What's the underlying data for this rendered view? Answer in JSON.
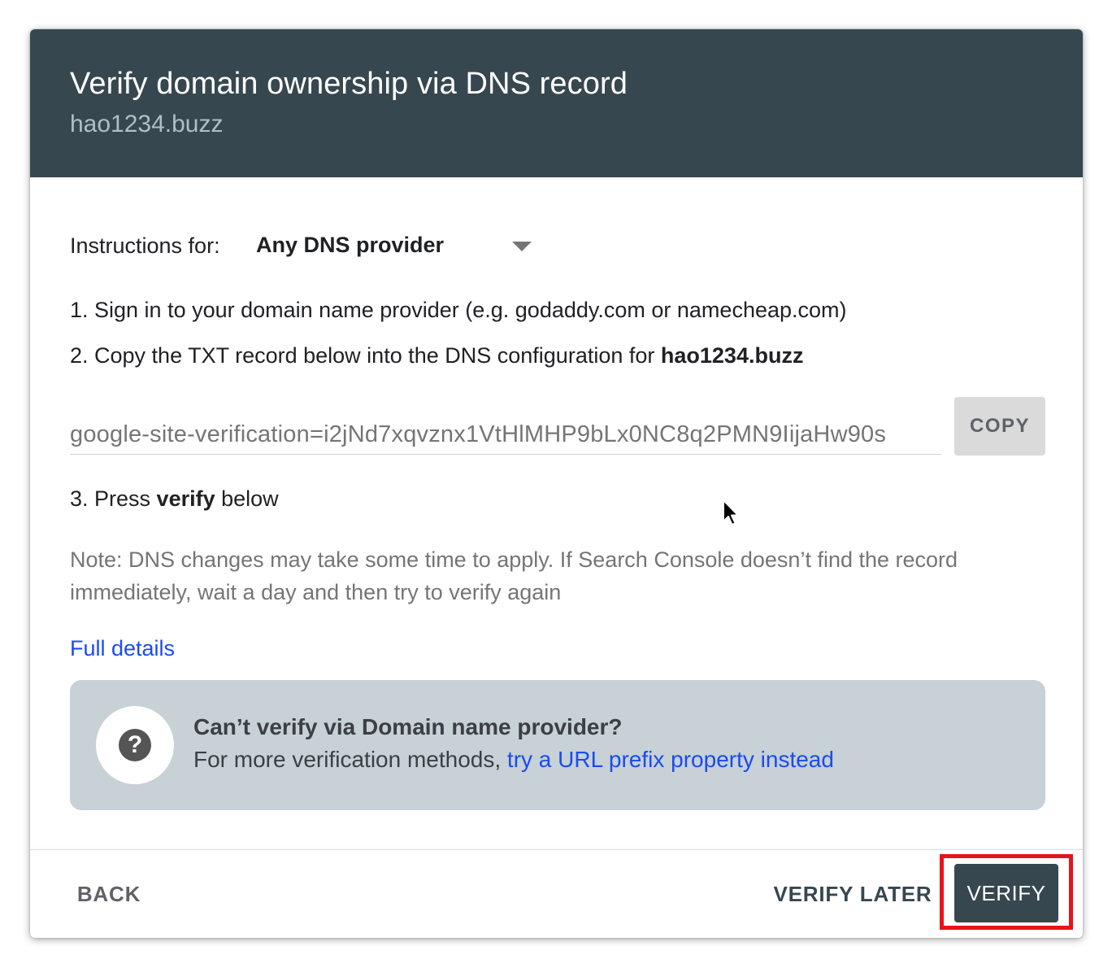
{
  "dialog": {
    "title": "Verify domain ownership via DNS record",
    "subtitle": "hao1234.buzz"
  },
  "instructions": {
    "label": "Instructions for:",
    "provider_selected": "Any DNS provider"
  },
  "steps": {
    "step1": "1. Sign in to your domain name provider (e.g. godaddy.com or namecheap.com)",
    "step2_prefix": "2. Copy the TXT record below into the DNS configuration for ",
    "step2_domain": "hao1234.buzz",
    "step3_prefix": "3. Press ",
    "step3_bold": "verify",
    "step3_suffix": " below"
  },
  "txt_record": {
    "value": "google-site-verification=i2jNd7xqvznx1VtHlMHP9bLx0NC8q2PMN9IijaHw90s",
    "copy_label": "COPY"
  },
  "note": "Note: DNS changes may take some time to apply. If Search Console doesn’t find the record immediately, wait a day and then try to verify again",
  "full_details_link": "Full details",
  "help_box": {
    "title": "Can’t verify via Domain name provider?",
    "text_prefix": "For more verification methods, ",
    "link": "try a URL prefix property instead"
  },
  "footer": {
    "back_label": "BACK",
    "verify_later_label": "VERIFY LATER",
    "verify_label": "VERIFY"
  },
  "colors": {
    "header_bg": "#37474f",
    "link": "#1a4bf0",
    "highlight": "#e8141a",
    "help_box_bg": "#c7d1d6"
  }
}
